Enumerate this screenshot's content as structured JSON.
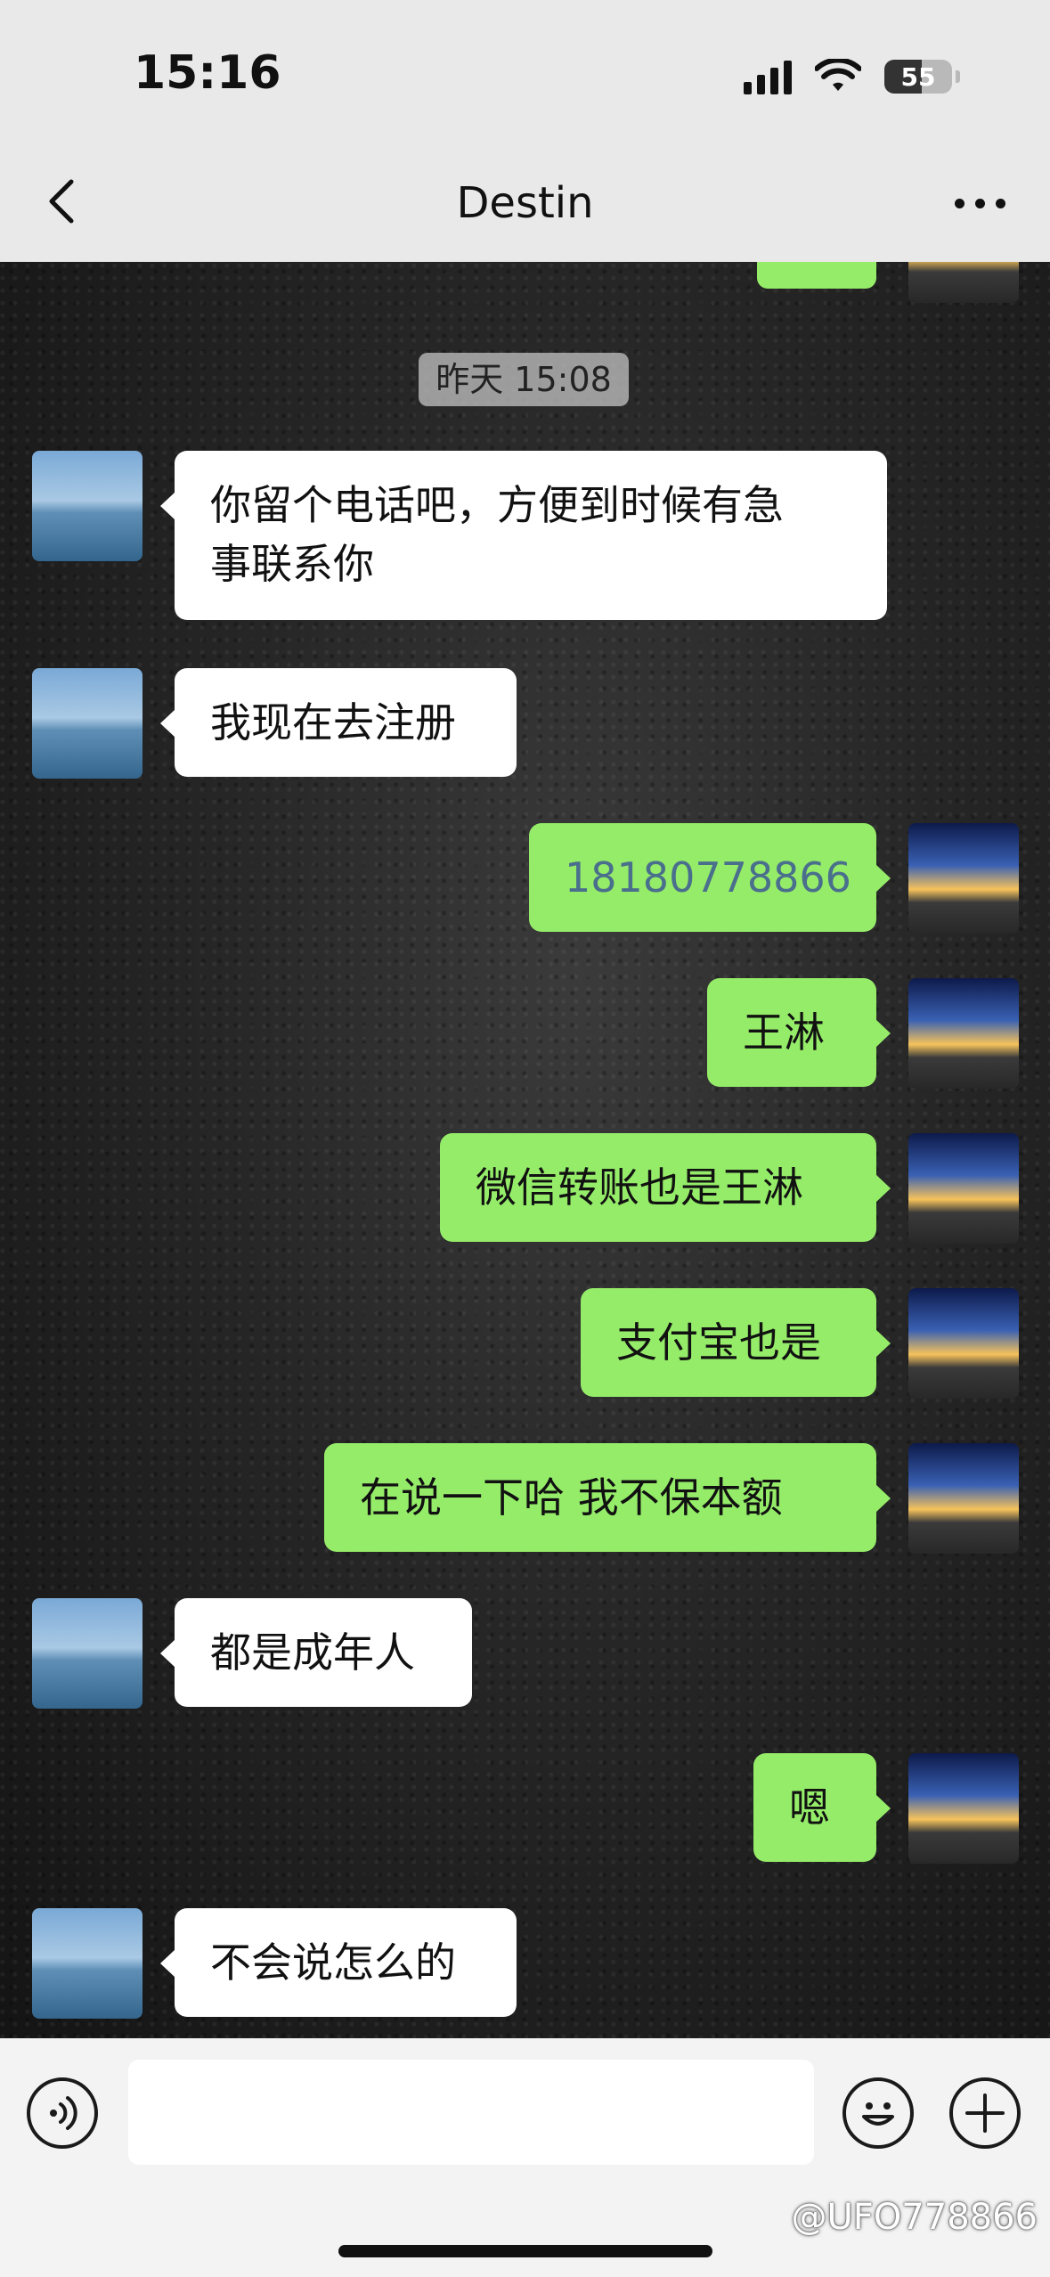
{
  "status_bar": {
    "time": "15:16",
    "battery": "55",
    "battery_level": 0.55
  },
  "nav": {
    "title": "Destin"
  },
  "chat": {
    "timestamp": "昨天 15:08",
    "messages": [
      {
        "side": "them",
        "lines": [
          "你留个电话吧，方便到时候有急",
          "事联系你"
        ]
      },
      {
        "side": "them",
        "lines": [
          "我现在去注册"
        ]
      },
      {
        "side": "me",
        "lines": [
          "18180778866"
        ],
        "is_phone": true
      },
      {
        "side": "me",
        "lines": [
          "王淋"
        ]
      },
      {
        "side": "me",
        "lines": [
          "微信转账也是王淋"
        ]
      },
      {
        "side": "me",
        "lines": [
          "支付宝也是"
        ]
      },
      {
        "side": "me",
        "lines": [
          "在说一下哈 我不保本额"
        ]
      },
      {
        "side": "them",
        "lines": [
          "都是成年人"
        ]
      },
      {
        "side": "me",
        "lines": [
          "嗯"
        ]
      },
      {
        "side": "them",
        "lines": [
          "不会说怎么的"
        ]
      }
    ]
  },
  "input": {
    "watermark": "@UFO778866"
  },
  "icons": {
    "back": "chevron-left-icon",
    "more": "more-dots-icon",
    "voice": "voice-icon",
    "emoji": "emoji-icon",
    "plus": "plus-icon"
  },
  "colors": {
    "outgoing": "#95ec69",
    "incoming": "#ffffff",
    "phone_link": "#4a6f8c"
  }
}
